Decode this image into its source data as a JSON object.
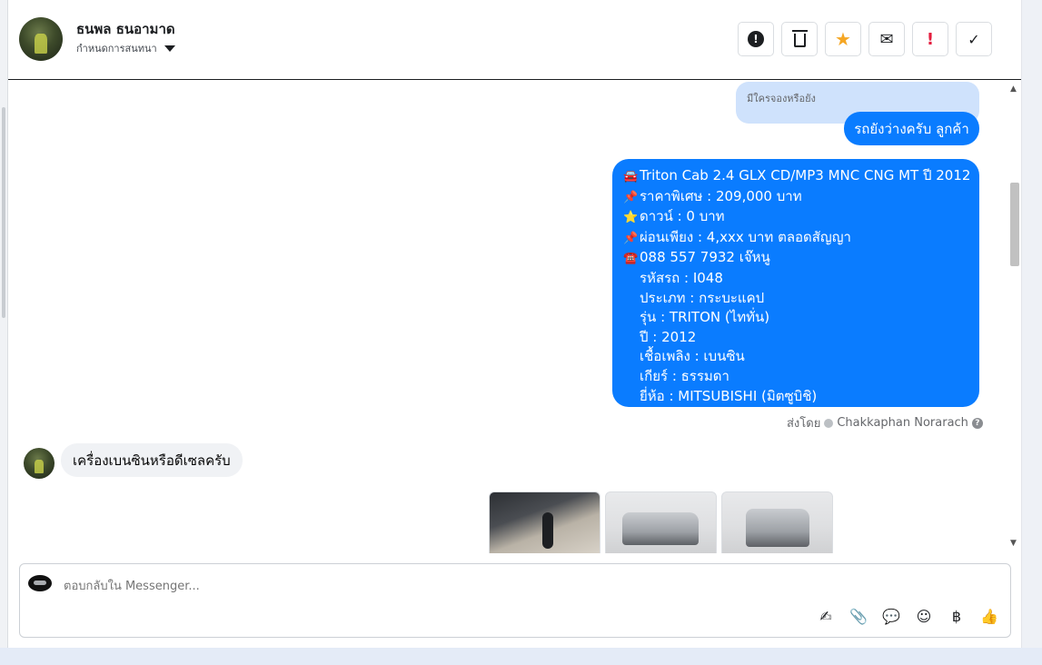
{
  "header": {
    "contact_name": "ธนพล ธนอามาด",
    "conversation_setting": "กำหนดการสนทนา",
    "actions": [
      {
        "name": "mark-spam-button",
        "icon": "alert-circle-icon",
        "glyph": "❗"
      },
      {
        "name": "delete-button",
        "icon": "trash-icon",
        "glyph": "🗑"
      },
      {
        "name": "star-button",
        "icon": "star-icon",
        "glyph": "★"
      },
      {
        "name": "mark-unread-button",
        "icon": "envelope-icon",
        "glyph": "✉"
      },
      {
        "name": "mark-important-button",
        "icon": "exclamation-icon",
        "glyph": "!"
      },
      {
        "name": "mark-done-button",
        "icon": "check-icon",
        "glyph": "✓"
      }
    ]
  },
  "messages": {
    "quoted_text": "มีใครจองหรือยัง",
    "reply_text": "รถยังว่างครับ ลูกค้า",
    "listing": {
      "lines": [
        {
          "emoji": "🚘",
          "text": "Triton Cab 2.4 GLX CD/MP3 MNC  CNG MT ปี 2012"
        },
        {
          "emoji": "📌",
          "text": "ราคาพิเศษ : 209,000 บาท"
        },
        {
          "emoji": "⭐",
          "text": "ดาวน์ : 0 บาท"
        },
        {
          "emoji": "📌",
          "text": "ผ่อนเพียง : 4,xxx บาท ตลอดสัญญา"
        },
        {
          "emoji": "☎️",
          "text": "088 557 7932 เจ๊หนู"
        },
        {
          "emoji": "",
          "text": "รหัสรถ : I048"
        },
        {
          "emoji": "",
          "text": "ประเภท : กระบะแคป"
        },
        {
          "emoji": "",
          "text": "รุ่น : TRITON (ไททั่น)"
        },
        {
          "emoji": "",
          "text": "ปี : 2012"
        },
        {
          "emoji": "",
          "text": "เชื้อเพลิง : เบนซิน"
        },
        {
          "emoji": "",
          "text": "เกียร์ : ธรรมดา"
        },
        {
          "emoji": "",
          "text": "ยี่ห้อ : MITSUBISHI (มิตซูบิชิ)"
        }
      ]
    },
    "sent_by_label": "ส่งโดย",
    "sent_by_name": "Chakkaphan Norarach",
    "incoming_text": "เครื่องเบนซินหรือดีเซลครับ"
  },
  "composer": {
    "placeholder": "ตอบกลับใน Messenger...",
    "tools": [
      {
        "name": "saved-reply-button",
        "icon": "saved-reply-icon",
        "glyph": "✍"
      },
      {
        "name": "attach-button",
        "icon": "paperclip-icon",
        "glyph": "📎"
      },
      {
        "name": "quick-reply-button",
        "icon": "speech-bubble-icon",
        "glyph": "💬"
      },
      {
        "name": "emoji-button",
        "icon": "smiley-icon",
        "glyph": "☺"
      },
      {
        "name": "payment-button",
        "icon": "baht-icon",
        "glyph": "฿"
      },
      {
        "name": "like-button",
        "icon": "thumbs-up-icon",
        "glyph": "👍"
      }
    ]
  },
  "colors": {
    "outgoing_bubble": "#0a7cff",
    "quoted_bubble": "#cfe2fc",
    "incoming_bubble": "#f0f2f5",
    "star_accent": "#f5a623",
    "important_accent": "#e41e3f"
  }
}
